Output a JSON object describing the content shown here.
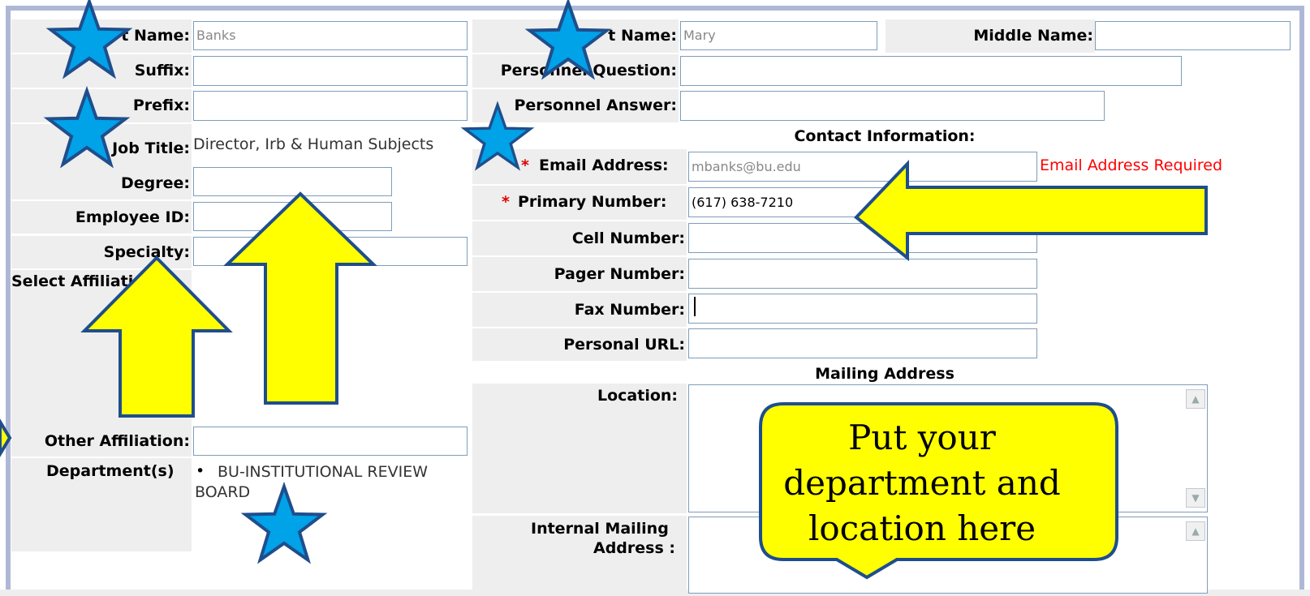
{
  "left_column": {
    "last_name_label": "t Name:",
    "last_name_value": "Banks",
    "suffix_label": "Suffix:",
    "prefix_label": "Prefix:",
    "job_title_label": "Job Title:",
    "job_title_value": "Director, Irb & Human Subjects",
    "degree_label": "Degree:",
    "employee_id_label": "Employee ID:",
    "specialty_label": "Specialty:",
    "select_affiliation_label": "Select Affiliations:",
    "other_affiliation_label": "Other Affiliation:",
    "departments_label": "Department(s)",
    "departments": [
      "BU-INSTITUTIONAL REVIEW BOARD"
    ]
  },
  "right_column": {
    "first_name_label": "t Name:",
    "first_name_value": "Mary",
    "middle_name_label": "Middle Name:",
    "personnel_question_label": "Personnel Question:",
    "personnel_answer_label": "Personnel Answer:",
    "contact_header": "Contact Information:",
    "required_marker": "*",
    "email_label": "Email Address:",
    "email_value": "mbanks@bu.edu",
    "email_error": "Email Address Required",
    "primary_number_label": "Primary Number:",
    "primary_number_value": "(617) 638-7210",
    "cell_number_label": "Cell Number:",
    "pager_number_label": "Pager Number:",
    "fax_number_label": "Fax Number:",
    "personal_url_label": "Personal URL:",
    "mailing_header": "Mailing Address",
    "location_label": "Location:",
    "internal_mailing_label_1": "Internal Mailing",
    "internal_mailing_label_2": "Address :"
  },
  "callout": {
    "line1": "Put your",
    "line2": "department and",
    "line3": "location here"
  },
  "colors": {
    "star_fill": "#00a2e8",
    "star_stroke": "#1f4e8c",
    "arrow_fill": "#ffff00",
    "callout_fill": "#ffff00",
    "required": "#e00000",
    "label_bg": "#eeeeee",
    "frame": "#aeb8d6"
  }
}
